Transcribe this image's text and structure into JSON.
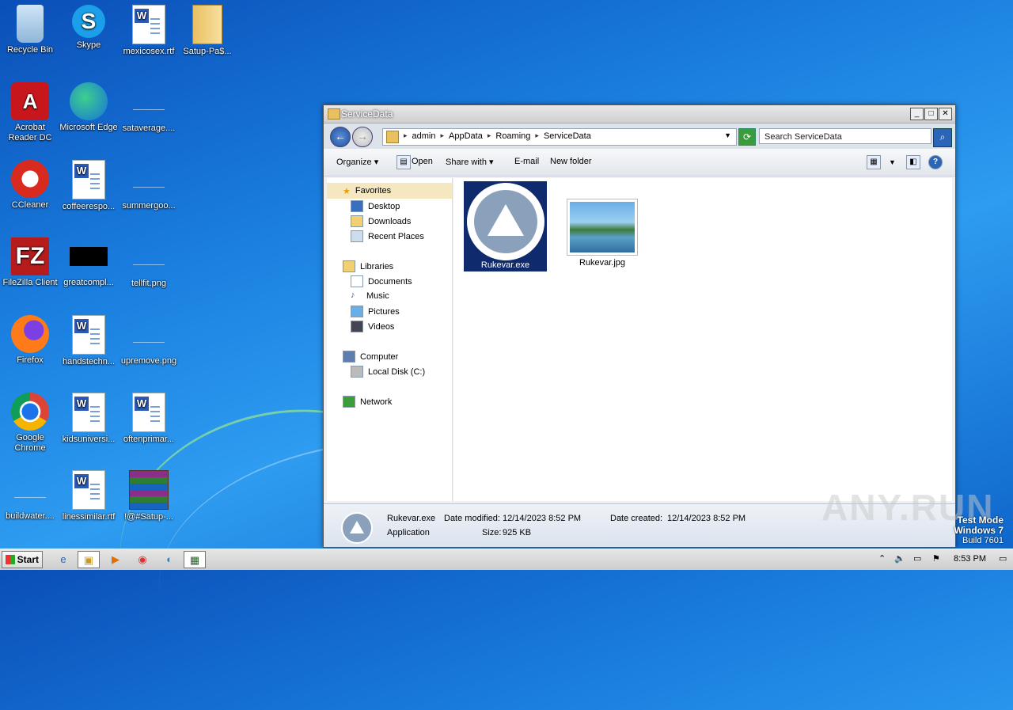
{
  "desktop": {
    "icons": [
      {
        "label": "Recycle Bin",
        "icon": "recycle-bin-icon"
      },
      {
        "label": "Skype",
        "icon": "skype-icon"
      },
      {
        "label": "mexicosex.rtf",
        "icon": "word-doc-icon"
      },
      {
        "label": "Satup-Pa$...",
        "icon": "folder-zip-icon"
      },
      {
        "label": "Acrobat Reader DC",
        "icon": "acrobat-icon"
      },
      {
        "label": "Microsoft Edge",
        "icon": "edge-icon"
      },
      {
        "label": "sataverage....",
        "icon": "blank-file-icon"
      },
      {
        "label": "CCleaner",
        "icon": "ccleaner-icon"
      },
      {
        "label": "coffeerespo...",
        "icon": "word-doc-icon"
      },
      {
        "label": "summergoo...",
        "icon": "blank-file-icon"
      },
      {
        "label": "FileZilla Client",
        "icon": "filezilla-icon"
      },
      {
        "label": "greatcompl...",
        "icon": "black-image-icon"
      },
      {
        "label": "tellfit.png",
        "icon": "blank-file-icon"
      },
      {
        "label": "Firefox",
        "icon": "firefox-icon"
      },
      {
        "label": "handstechn...",
        "icon": "word-doc-icon"
      },
      {
        "label": "upremove.png",
        "icon": "blank-file-icon"
      },
      {
        "label": "Google Chrome",
        "icon": "chrome-icon"
      },
      {
        "label": "kidsuniversi...",
        "icon": "word-doc-icon"
      },
      {
        "label": "oftenprimar...",
        "icon": "word-doc-icon"
      },
      {
        "label": "buildwater....",
        "icon": "blank-file-icon"
      },
      {
        "label": "linessimilar.rtf",
        "icon": "word-doc-icon"
      },
      {
        "label": "!@#Satup-...",
        "icon": "winrar-icon"
      }
    ]
  },
  "window": {
    "title": "ServiceData",
    "breadcrumb": [
      "admin",
      "AppData",
      "Roaming",
      "ServiceData"
    ],
    "search_placeholder": "Search ServiceData",
    "toolbar": {
      "organize": "Organize",
      "open": "Open",
      "share_with": "Share with",
      "email": "E-mail",
      "new_folder": "New folder"
    },
    "nav": {
      "favorites": "Favorites",
      "desktop": "Desktop",
      "downloads": "Downloads",
      "recent_places": "Recent Places",
      "libraries": "Libraries",
      "documents": "Documents",
      "music": "Music",
      "pictures": "Pictures",
      "videos": "Videos",
      "computer": "Computer",
      "local_disk": "Local Disk (C:)",
      "network": "Network"
    },
    "files": [
      {
        "name": "Rukevar.exe",
        "selected": true
      },
      {
        "name": "Rukevar.jpg",
        "selected": false
      }
    ],
    "status": {
      "filename": "Rukevar.exe",
      "type": "Application",
      "modified_label": "Date modified:",
      "modified": "12/14/2023 8:52 PM",
      "size_label": "Size:",
      "size": "925 KB",
      "created_label": "Date created:",
      "created": "12/14/2023 8:52 PM"
    }
  },
  "taskbar": {
    "start": "Start",
    "clock": "8:53 PM"
  },
  "watermark": {
    "line1": "Test Mode",
    "line2": "Windows 7",
    "line3": "Build 7601",
    "brand": "ANY.RUN"
  },
  "colors": {
    "selection": "#102a6e",
    "desktop_blue": "#1a7fe0"
  }
}
